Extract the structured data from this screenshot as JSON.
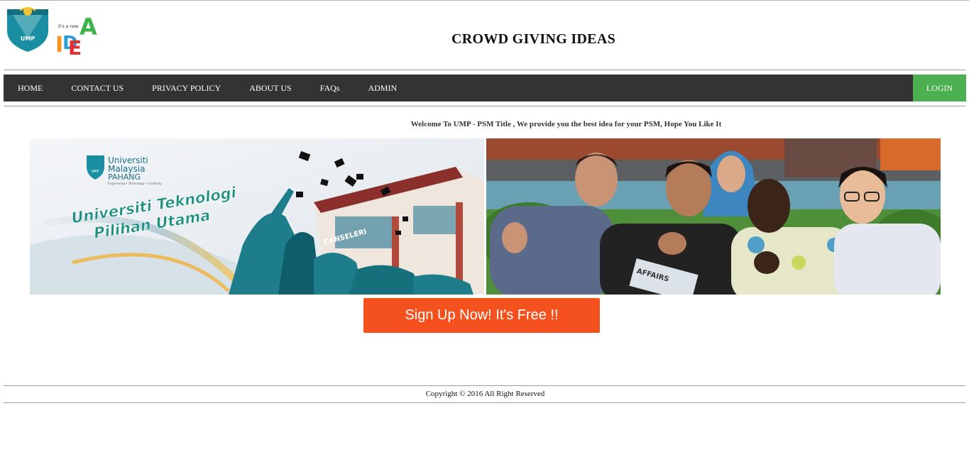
{
  "header": {
    "title": "CROWD GIVING IDEAS",
    "ump_logo_text": "UMP",
    "idea_logo_tagline": "it's a new",
    "idea_logo_letters": [
      "I",
      "D",
      "E",
      "A"
    ]
  },
  "nav": {
    "items": [
      {
        "label": "HOME"
      },
      {
        "label": "CONTACT US"
      },
      {
        "label": "PRIVACY POLICY"
      },
      {
        "label": "ABOUT US"
      },
      {
        "label": "FAQs"
      },
      {
        "label": "ADMIN"
      }
    ],
    "login_label": "LOGIN"
  },
  "welcome_text": "Welcome To UMP - PSM Title , We provide you the best idea for your PSM, Hope You Like It",
  "banner": {
    "university_line1": "Universiti",
    "university_line2": "Malaysia",
    "university_line3": "PAHANG",
    "university_subline": "Engineering • Technology • Creativity",
    "slogan_line1": "Universiti Teknologi",
    "slogan_line2": "Pilihan Utama",
    "building_sign": "CANSELERI",
    "crest_text": "UMP",
    "newspaper_text": "AFFAIRS"
  },
  "signup_label": "Sign Up Now! It's Free !!",
  "footer": {
    "copyright": "Copyright © 2016 All Right Reserved"
  },
  "colors": {
    "nav_bg": "#333333",
    "login_bg": "#4caf50",
    "signup_bg": "#f4511e",
    "ump_blue": "#1a8fa3",
    "idea_red": "#e52f2f",
    "idea_green": "#3db34a",
    "idea_orange": "#f7941d",
    "idea_blue": "#2aa0d9"
  }
}
